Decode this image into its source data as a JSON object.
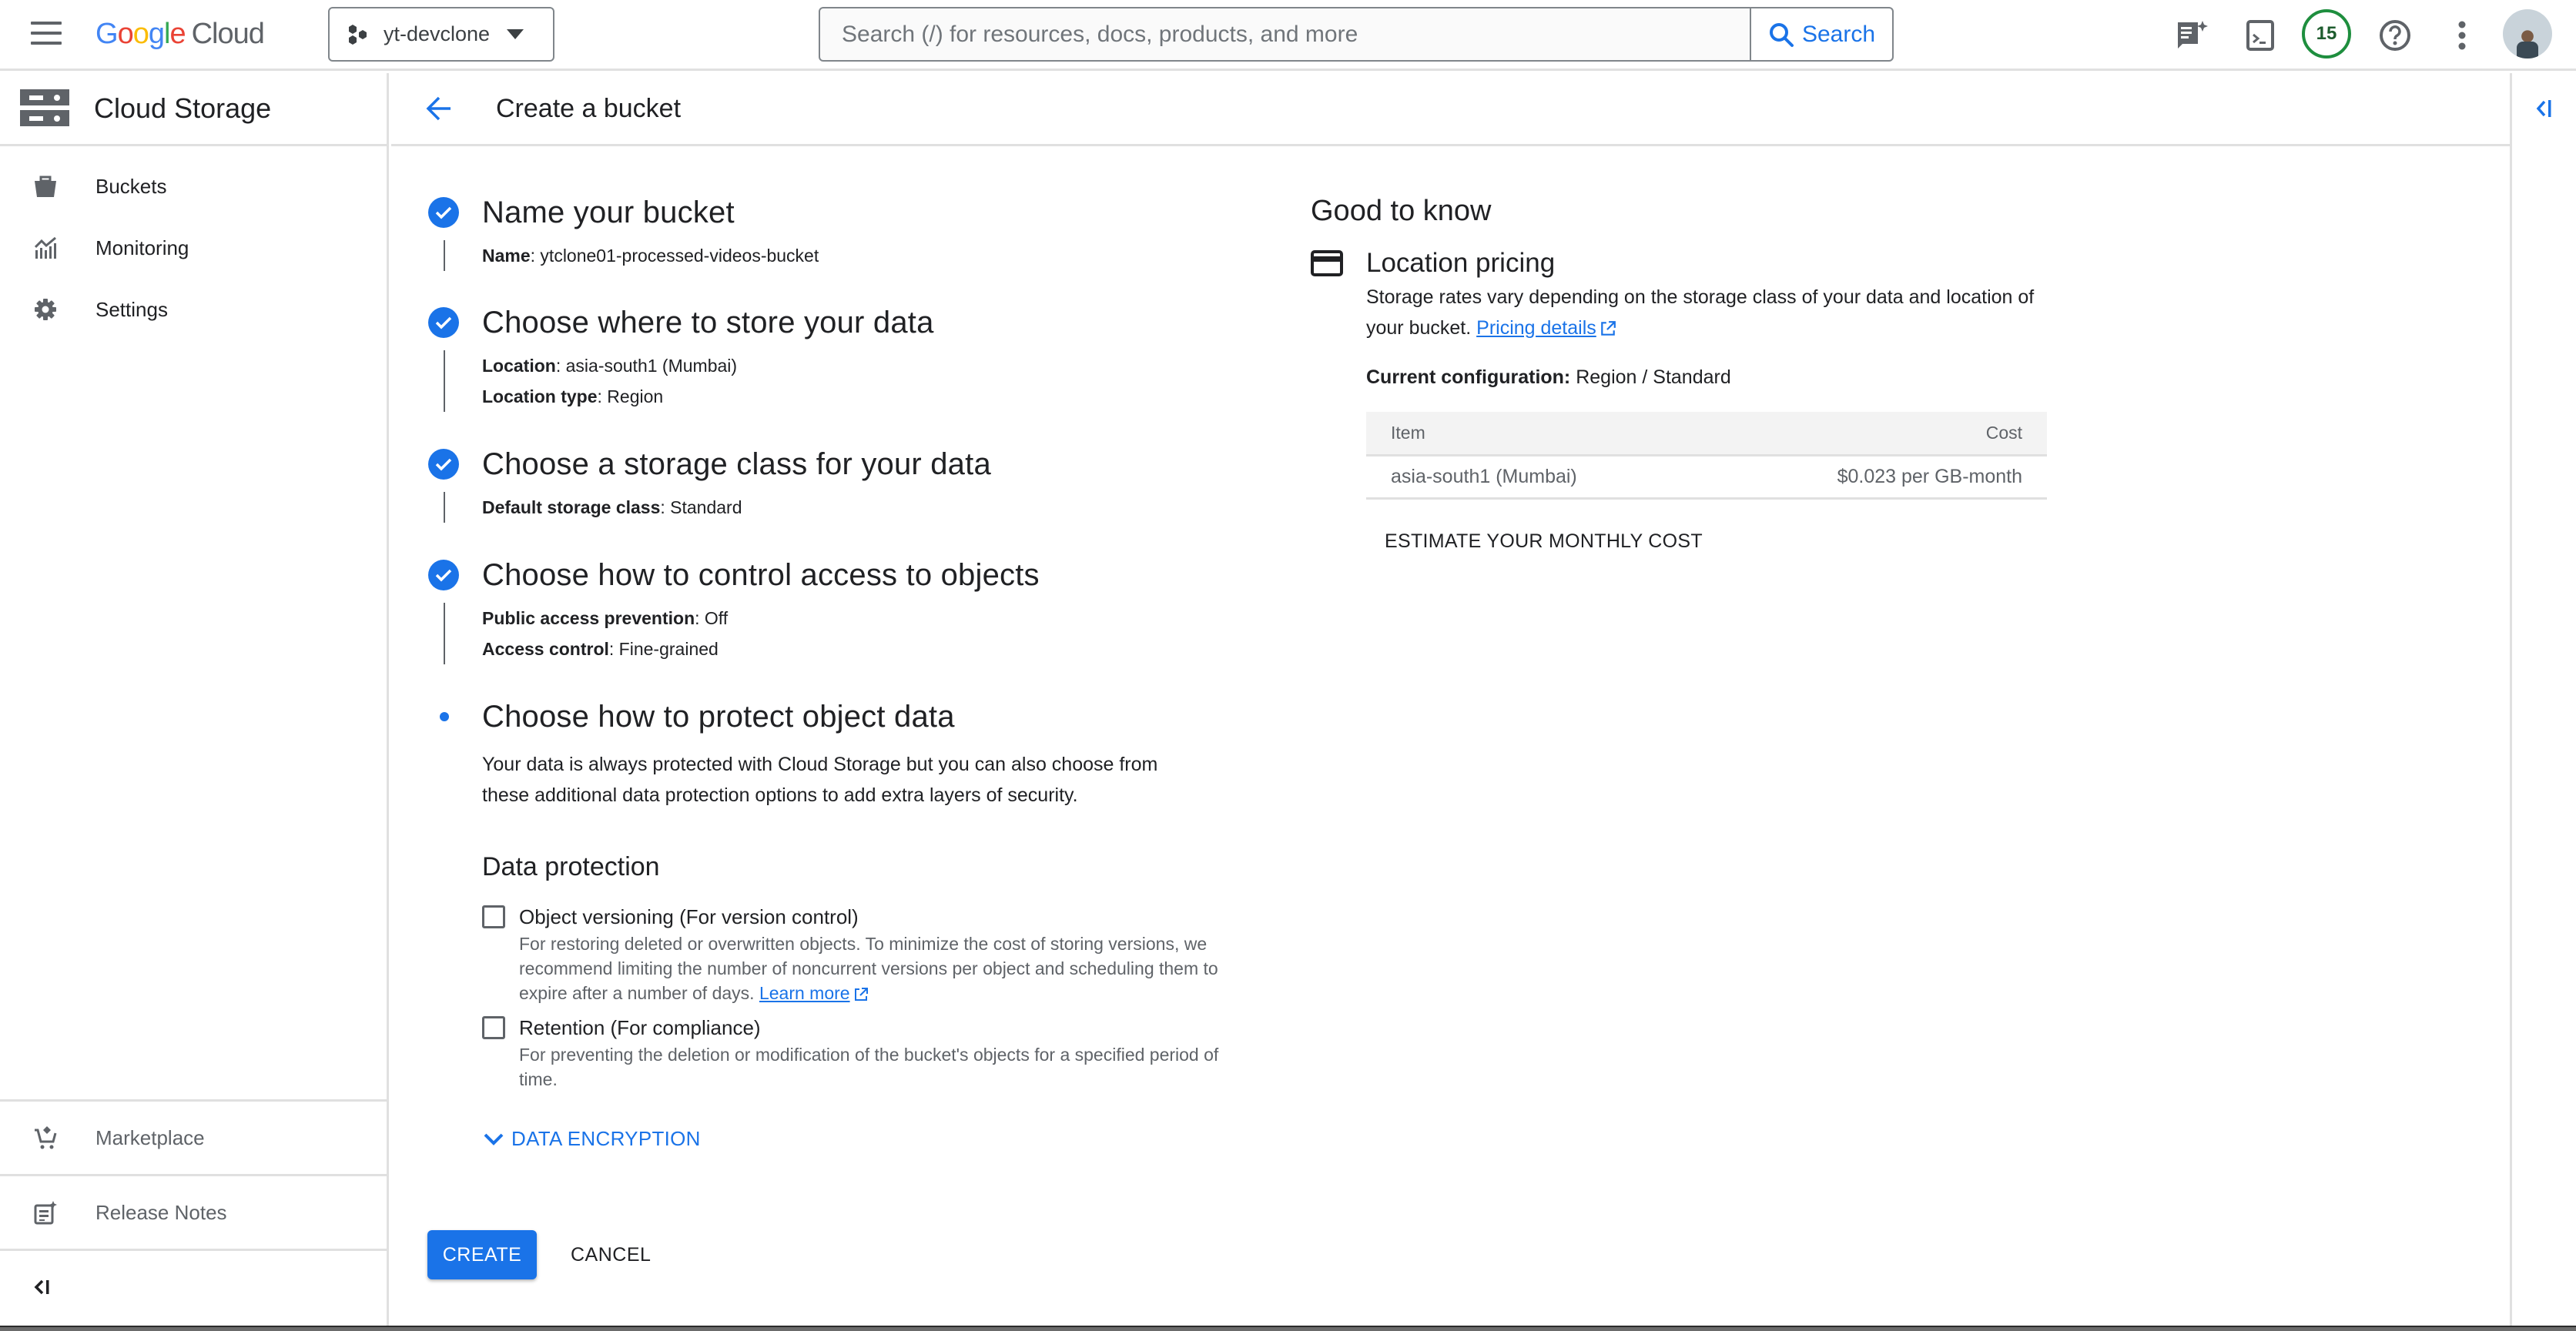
{
  "topbar": {
    "logo_letters": [
      "G",
      "o",
      "o",
      "g",
      "l",
      "e"
    ],
    "logo_product": "Cloud",
    "project_name": "yt-devclone",
    "search_placeholder": "Search (/) for resources, docs, products, and more",
    "search_button": "Search",
    "notifications_count": "15",
    "icons": [
      "menu-icon",
      "project-icon",
      "search-icon",
      "gemini-notes-icon",
      "cloud-shell-icon",
      "help-icon",
      "more-vert-icon",
      "avatar"
    ]
  },
  "sidebar": {
    "title": "Cloud Storage",
    "items": [
      {
        "label": "Buckets",
        "icon": "bucket-icon"
      },
      {
        "label": "Monitoring",
        "icon": "monitoring-icon"
      },
      {
        "label": "Settings",
        "icon": "gear-icon"
      }
    ],
    "bottom_items": [
      {
        "label": "Marketplace",
        "icon": "marketplace-cart-icon"
      },
      {
        "label": "Release Notes",
        "icon": "release-notes-icon"
      }
    ],
    "collapse_icon": "collapse-left-icon"
  },
  "page": {
    "title": "Create a bucket",
    "back_icon": "arrow-back-icon"
  },
  "steps": [
    {
      "title": "Name your bucket",
      "status": "complete",
      "summary": [
        {
          "key": "Name",
          "value": ": ytclone01-processed-videos-bucket"
        }
      ]
    },
    {
      "title": "Choose where to store your data",
      "status": "complete",
      "summary": [
        {
          "key": "Location",
          "value": ": asia-south1 (Mumbai)"
        },
        {
          "key": "Location type",
          "value": ": Region"
        }
      ]
    },
    {
      "title": "Choose a storage class for your data",
      "status": "complete",
      "summary": [
        {
          "key": "Default storage class",
          "value": ": Standard"
        }
      ]
    },
    {
      "title": "Choose how to control access to objects",
      "status": "complete",
      "summary": [
        {
          "key": "Public access prevention",
          "value": ": Off"
        },
        {
          "key": "Access control",
          "value": ": Fine-grained"
        }
      ]
    },
    {
      "title": "Choose how to protect object data",
      "status": "active",
      "description": "Your data is always protected with Cloud Storage but you can also choose from these additional data protection options to add extra layers of security.",
      "section_title": "Data protection",
      "options": [
        {
          "label": "Object versioning (For version control)",
          "checked": false,
          "description": "For restoring deleted or overwritten objects. To minimize the cost of storing versions, we recommend limiting the number of noncurrent versions per object and scheduling them to expire after a number of days.",
          "link": "Learn more"
        },
        {
          "label": "Retention (For compliance)",
          "checked": false,
          "description": "For preventing the deletion or modification of the bucket's objects for a specified period of time."
        }
      ],
      "expand_label": "DATA ENCRYPTION"
    }
  ],
  "actions": {
    "create": "CREATE",
    "cancel": "CANCEL"
  },
  "good_to_know": {
    "title": "Good to know",
    "pricing_title": "Location pricing",
    "pricing_desc": "Storage rates vary depending on the storage class of your data and location of your bucket.",
    "pricing_link": "Pricing details",
    "config_label": "Current configuration:",
    "config_value": " Region / Standard",
    "table": {
      "headers": [
        "Item",
        "Cost"
      ],
      "rows": [
        [
          "asia-south1 (Mumbai)",
          "$0.023 per GB-month"
        ]
      ]
    },
    "estimate_button": "ESTIMATE YOUR MONTHLY COST"
  },
  "colors": {
    "accent": "#1a73e8",
    "badge_ring": "#1e8e3e",
    "text": "#202124",
    "muted": "#5f6368"
  }
}
